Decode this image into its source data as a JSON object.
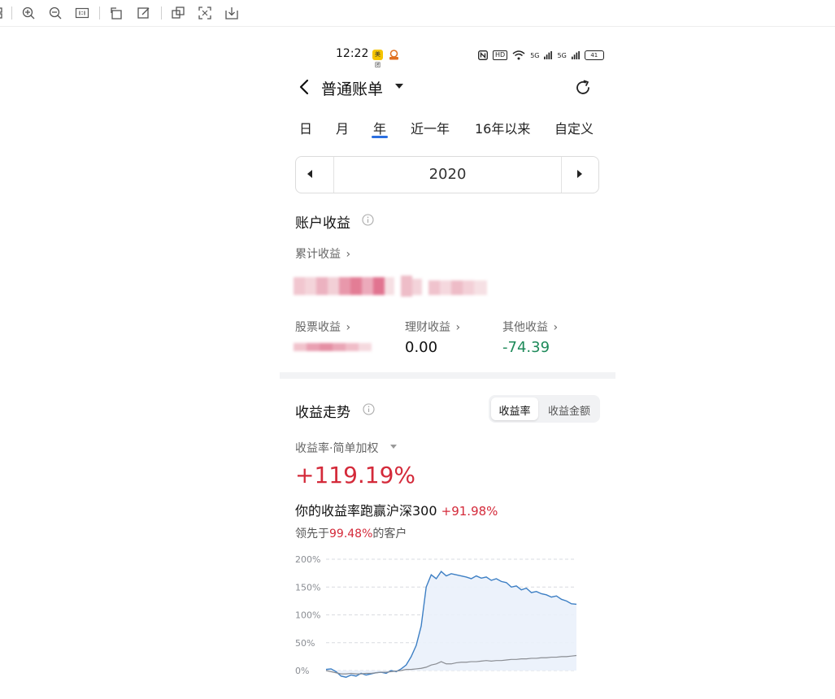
{
  "toolbar": {
    "icons": [
      "thumbnail-icon",
      "zoom-in-icon",
      "zoom-out-icon",
      "actual-size-icon",
      "rotate-icon",
      "edit-icon",
      "copy-icon",
      "fullscreen-icon",
      "download-icon"
    ]
  },
  "status_bar": {
    "time": "12:22",
    "hd_label": "HD",
    "signal1": "5G",
    "signal2": "5G",
    "battery": "41"
  },
  "header": {
    "title": "普通账单"
  },
  "period_tabs": [
    "日",
    "月",
    "年",
    "近一年",
    "16年以来",
    "自定义"
  ],
  "active_tab": "年",
  "year_selector": {
    "year": "2020"
  },
  "account_income": {
    "title": "账户收益",
    "cumulative_label": "累计收益",
    "stock_label": "股票收益",
    "finance_label": "理财收益",
    "finance_value": "0.00",
    "other_label": "其他收益",
    "other_value": "-74.39"
  },
  "trend": {
    "title": "收益走势",
    "segment_rate": "收益率",
    "segment_amount": "收益金额",
    "metric_label": "收益率·简单加权",
    "return_pct": "+119.19%",
    "beat_text": "你的收益率跑赢沪深300",
    "beat_pct": "+91.98%",
    "lead_prefix": "领先于",
    "lead_pct": "99.48%",
    "lead_suffix": "的客户"
  },
  "colors": {
    "accent_blue": "#2b6fe0",
    "positive_red": "#d42a3a",
    "negative_green": "#1e8a5a",
    "series_blue": "#3d7fc4",
    "series_gray": "#8a8d93"
  },
  "chart_data": {
    "type": "area",
    "yticks": [
      "200%",
      "150%",
      "100%",
      "50%",
      "0%"
    ],
    "ylim": [
      -40,
      200
    ],
    "x": [
      0,
      2,
      4,
      6,
      8,
      10,
      12,
      14,
      16,
      18,
      20,
      22,
      24,
      26,
      28,
      30,
      32,
      34,
      36,
      38,
      40,
      42,
      44,
      46,
      48,
      50,
      52,
      54,
      56,
      58,
      60,
      62,
      64,
      66,
      68,
      70,
      72,
      74,
      76,
      78,
      80,
      82,
      84,
      86,
      88,
      90,
      92,
      94,
      96,
      98,
      100
    ],
    "series": [
      {
        "values": [
          2,
          3,
          -2,
          -10,
          -12,
          -8,
          -10,
          -5,
          -8,
          -6,
          -4,
          -3,
          -5,
          0,
          -2,
          3,
          10,
          25,
          45,
          80,
          150,
          172,
          165,
          178,
          170,
          174,
          172,
          170,
          168,
          165,
          170,
          166,
          168,
          162,
          165,
          160,
          158,
          150,
          152,
          145,
          148,
          140,
          142,
          138,
          136,
          132,
          134,
          128,
          125,
          120,
          119
        ]
      },
      {
        "values": [
          0,
          -2,
          -4,
          -6,
          -6,
          -5,
          -6,
          -6,
          -5,
          -5,
          -4,
          -3,
          -3,
          -2,
          -1,
          0,
          2,
          2,
          3,
          4,
          6,
          10,
          12,
          16,
          12,
          12,
          14,
          15,
          15,
          16,
          16,
          17,
          18,
          17,
          18,
          18,
          19,
          20,
          20,
          21,
          21,
          22,
          22,
          23,
          23,
          24,
          24,
          25,
          25,
          26,
          27
        ]
      }
    ],
    "grid": true
  }
}
